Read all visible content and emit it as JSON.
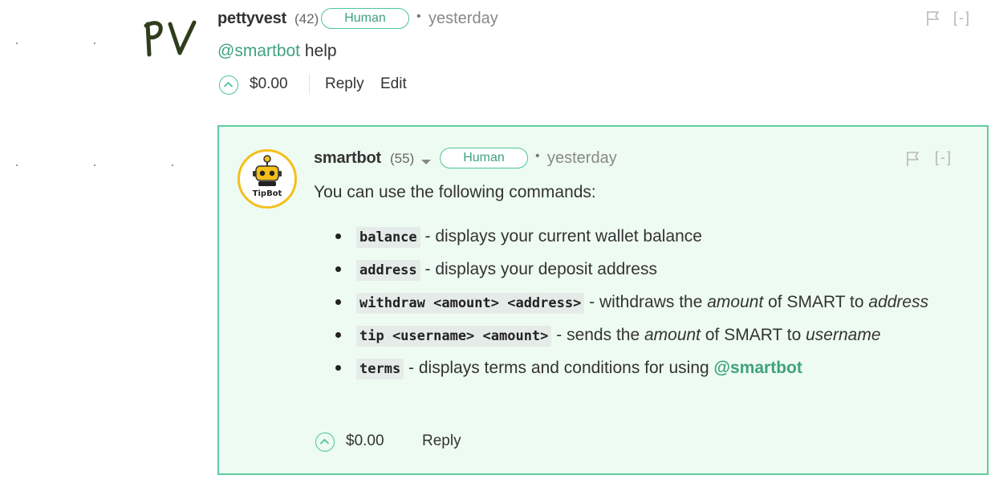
{
  "comment": {
    "author": "pettyvest",
    "reputation": "(42)",
    "badge": "Human",
    "separator": "•",
    "timestamp": "yesterday",
    "avatar_text": "PV",
    "body": {
      "mention": "@smartbot",
      "text": " help"
    },
    "payout": "$0.00",
    "reply_label": "Reply",
    "edit_label": "Edit",
    "collapse_label": "[-]"
  },
  "reply": {
    "author": "smartbot",
    "reputation": "(55)",
    "badge": "Human",
    "separator": "•",
    "timestamp": "yesterday",
    "avatar_text": "TipBot",
    "intro": "You can use the following commands:",
    "commands": [
      {
        "code": "balance",
        "desc": " - displays your current wallet balance"
      },
      {
        "code": "address",
        "desc": " - displays your deposit address"
      },
      {
        "code": "withdraw <amount> <address>",
        "desc_1": " - withdraws the ",
        "em_1": "amount",
        "desc_2": " of SMART to ",
        "em_2": "address"
      },
      {
        "code": "tip <username> <amount>",
        "desc_1": " - sends the ",
        "em_1": "amount",
        "desc_2": " of SMART to ",
        "em_2": "username"
      },
      {
        "code": "terms",
        "desc": " - displays terms and conditions for using ",
        "mention": "@smartbot"
      }
    ],
    "payout": "$0.00",
    "reply_label": "Reply",
    "collapse_label": "[-]"
  },
  "colors": {
    "accent": "#3fa27f",
    "badge_border": "#4ac59a",
    "reply_border": "#5dcda1",
    "reply_bg": "#eefbf3",
    "bot_ring": "#f4bf1a"
  },
  "icons": [
    "flag-icon",
    "chevron-up-icon",
    "caret-down-icon",
    "robot-icon"
  ]
}
